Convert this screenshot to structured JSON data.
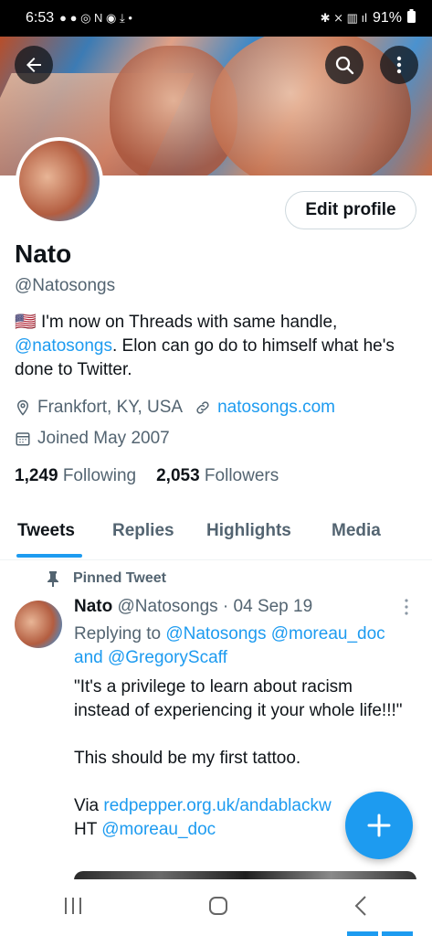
{
  "status_bar": {
    "time": "6:53",
    "battery": "91%"
  },
  "header": {
    "back_icon": "arrow-left-icon",
    "search_icon": "search-icon",
    "more_icon": "more-vertical-icon"
  },
  "profile": {
    "edit_label": "Edit profile",
    "name": "Nato",
    "handle": "@Natosongs",
    "bio_flag": "🇺🇸",
    "bio_part1": " I'm now on Threads with same handle, ",
    "bio_link": "@natosongs",
    "bio_part2": ". Elon can go do to himself what he's done to Twitter.",
    "location": "Frankfort, KY, USA",
    "website": "natosongs.com",
    "joined": "Joined May 2007",
    "following_count": "1,249",
    "following_label": "Following",
    "followers_count": "2,053",
    "followers_label": "Followers"
  },
  "tabs": [
    {
      "label": "Tweets",
      "active": true
    },
    {
      "label": "Replies"
    },
    {
      "label": "Highlights"
    },
    {
      "label": "Media"
    }
  ],
  "tweet": {
    "pinned_label": "Pinned Tweet",
    "author_name": "Nato",
    "author_handle": "@Natosongs",
    "separator": "·",
    "date": "04 Sep 19",
    "replying_prefix": "Replying to ",
    "reply_1": "@Natosongs",
    "reply_2": "@moreau_doc",
    "reply_and": "and ",
    "reply_3": "@GregoryScaff",
    "quote": "\"It's a privilege to learn about racism instead of experiencing it your whole life!!!\"",
    "line2": "This should be my first tattoo.",
    "via_prefix": "Via ",
    "via_link": "redpepper.org.uk/andablackw",
    "ht_prefix": "HT ",
    "ht_link": "@moreau_doc"
  },
  "colors": {
    "accent": "#1d9bf0",
    "text": "#0f1419",
    "muted": "#536471"
  }
}
